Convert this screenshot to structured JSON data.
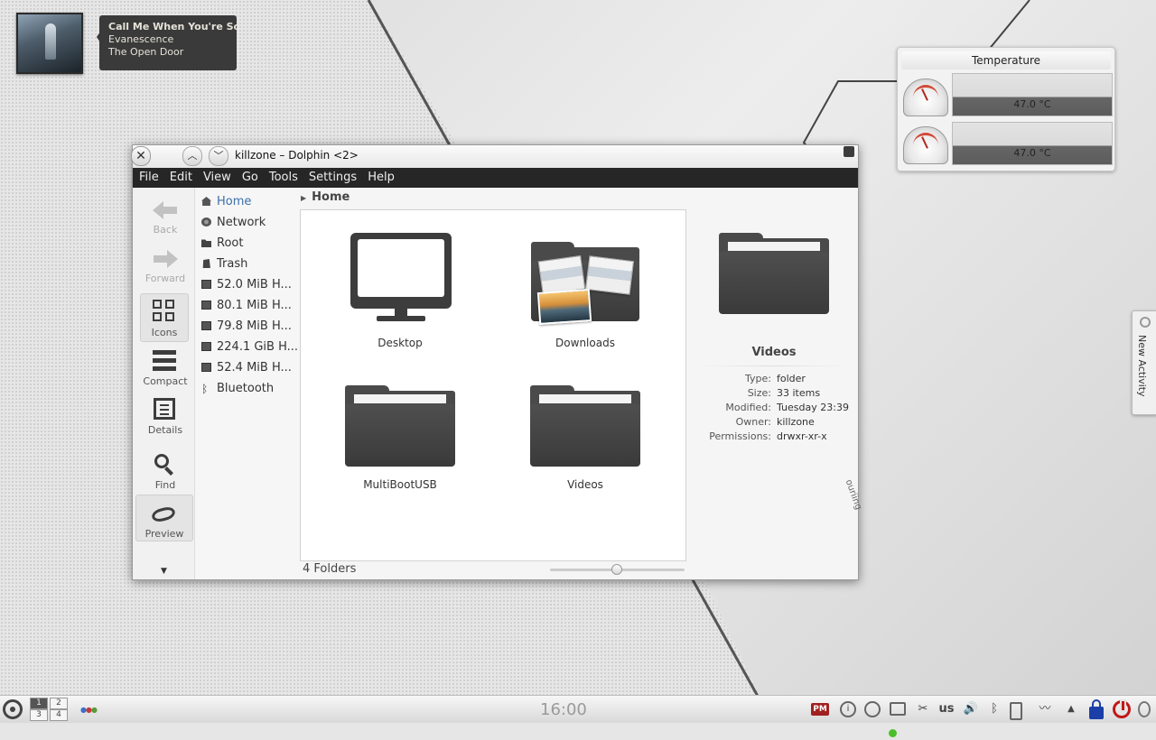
{
  "now_playing": {
    "title": "Call Me When You're Sob...",
    "artist": "Evanescence",
    "album": "The Open Door"
  },
  "temperature_widget": {
    "title": "Temperature",
    "sensors": [
      {
        "value": "47.0 °C"
      },
      {
        "value": "47.0 °C"
      }
    ]
  },
  "window": {
    "title": "killzone – Dolphin <2>",
    "menu": [
      "File",
      "Edit",
      "View",
      "Go",
      "Tools",
      "Settings",
      "Help"
    ],
    "toolbar": {
      "back": "Back",
      "forward": "Forward",
      "icons": "Icons",
      "compact": "Compact",
      "details": "Details",
      "find": "Find",
      "preview": "Preview"
    },
    "places": [
      {
        "label": "Home",
        "icon": "home-icon"
      },
      {
        "label": "Network",
        "icon": "network-icon"
      },
      {
        "label": "Root",
        "icon": "root-folder-icon"
      },
      {
        "label": "Trash",
        "icon": "trash-icon"
      },
      {
        "label": "52.0 MiB H...",
        "icon": "drive-icon"
      },
      {
        "label": "80.1 MiB H...",
        "icon": "drive-icon"
      },
      {
        "label": "79.8 MiB H...",
        "icon": "drive-icon"
      },
      {
        "label": "224.1 GiB H...",
        "icon": "drive-icon"
      },
      {
        "label": "52.4 MiB H...",
        "icon": "drive-icon"
      },
      {
        "label": "Bluetooth",
        "icon": "bluetooth-icon"
      }
    ],
    "breadcrumb": "Home",
    "items": [
      {
        "label": "Desktop"
      },
      {
        "label": "Downloads"
      },
      {
        "label": "MultiBootUSB"
      },
      {
        "label": "Videos"
      }
    ],
    "status": "4 Folders",
    "info_panel": {
      "name": "Videos",
      "rows": [
        {
          "key": "Type:",
          "value": "folder"
        },
        {
          "key": "Size:",
          "value": "33 items"
        },
        {
          "key": "Modified:",
          "value": "Tuesday 23:39"
        },
        {
          "key": "Owner:",
          "value": "killzone"
        },
        {
          "key": "Permissions:",
          "value": "drwxr-xr-x"
        }
      ]
    }
  },
  "side_tab": {
    "label": "New Activity"
  },
  "desktop_text": "ouriing",
  "panel": {
    "pager": [
      "1",
      "2",
      "3",
      "4"
    ],
    "clock": "16:00",
    "tray": {
      "pm": "PM",
      "info": "i",
      "keyboard_layout": "us"
    }
  }
}
